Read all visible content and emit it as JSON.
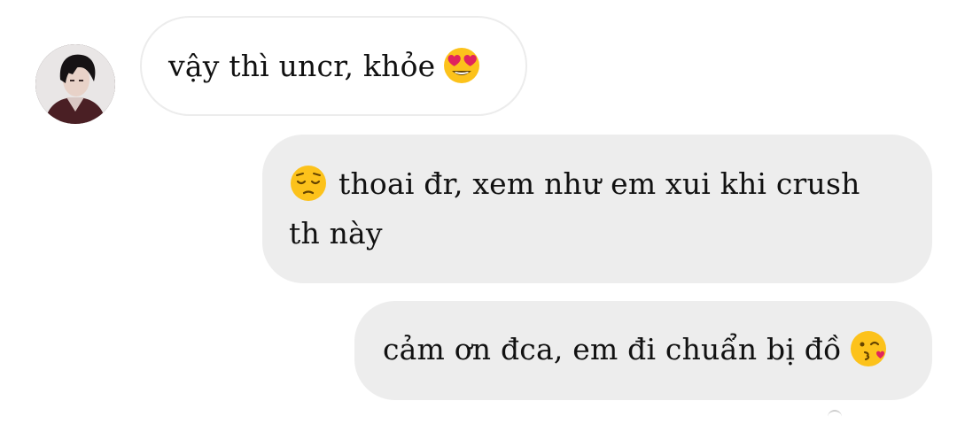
{
  "chat": {
    "contact": {
      "avatar_icon": "profile-photo"
    },
    "messages": [
      {
        "direction": "incoming",
        "text": "vậy thì uncr, khỏe",
        "emoji": "heart-eyes-emoji",
        "emoji_position": "end"
      },
      {
        "direction": "outgoing",
        "text": "thoai đr, xem như em xui khi crush th này",
        "emoji": "pensive-face-emoji",
        "emoji_position": "start"
      },
      {
        "direction": "outgoing",
        "text": "cảm ơn đca, em đi chuẩn bị đồ",
        "emoji": "kissing-heart-emoji",
        "emoji_position": "end"
      }
    ],
    "colors": {
      "incoming_bubble_bg": "#ffffff",
      "incoming_bubble_border": "#ececec",
      "outgoing_bubble_bg": "#ededed",
      "text": "#111111",
      "emoji_yellow": "#fcc21b"
    }
  }
}
